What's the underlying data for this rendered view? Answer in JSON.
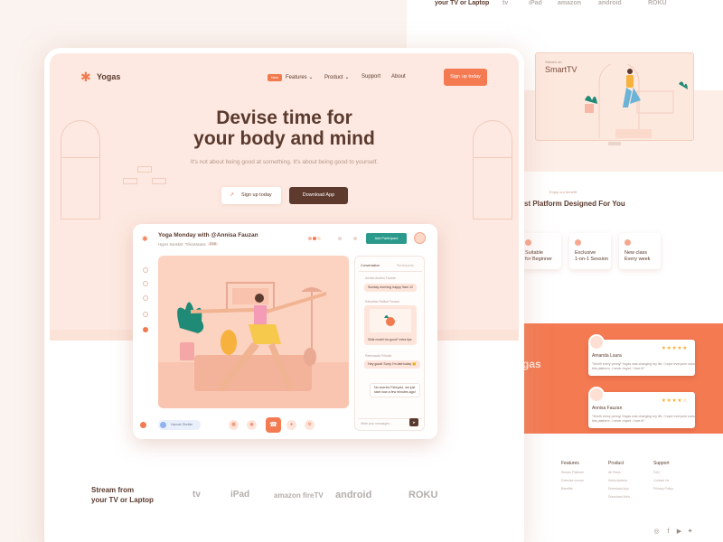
{
  "bg": {
    "stream_top": "your TV or Laptop",
    "brands_top": [
      "tv",
      "iPad",
      "amazon",
      "android",
      "ROKU"
    ],
    "smarttv_small": "Stream on",
    "smarttv_title": "SmartTV",
    "benefit_small": "Enjoy our benefit",
    "platform_title": "st Platform Designed For You",
    "features": [
      {
        "label": "Suitable\nfor Beginner"
      },
      {
        "label": "Exclusive\n1-on-1 Session"
      },
      {
        "label": "New class\nEvery week"
      }
    ],
    "brand_big": "gas",
    "reviews": [
      {
        "name": "Amanda Laura",
        "stars": "★★★★★",
        "text": "\"Worth every penny! Yogas was changing my life. I hope everyone uses this platform. I never regret. I love it!\""
      },
      {
        "name": "Annisa Fauzan",
        "stars": "★★★★☆",
        "text": "\"Worth every penny! Yogas was changing my life. I hope everyone uses this platform. I never regret. I love it!\""
      }
    ],
    "footer": [
      {
        "heading": "Features",
        "links": [
          "Stream Platform",
          "Exercise course",
          "Benefits"
        ]
      },
      {
        "heading": "Product",
        "links": [
          "All Plans",
          "Subscriptions",
          "Download App",
          "Download Web"
        ]
      },
      {
        "heading": "Support",
        "links": [
          "FAQ",
          "Contact Us",
          "Privacy Policy"
        ]
      }
    ],
    "social_icons": [
      "instagram-icon",
      "facebook-icon",
      "youtube-icon",
      "twitter-icon"
    ]
  },
  "main": {
    "logo": "Yogas",
    "nav": {
      "new_badge": "New",
      "items": [
        "Features",
        "Product",
        "Support",
        "About"
      ],
      "signup": "Sign up today"
    },
    "hero": {
      "title_line1": "Devise time for",
      "title_line2": "your body and mind",
      "subtitle": "It's not about being good at something. It's about being good to yourself.",
      "signup_btn": "Sign up today",
      "download_btn": "Download App"
    },
    "app": {
      "title": "Yoga Monday with @Annisa Fauzan",
      "subtitle": "Hyper Sanskrit: Trikonāsana",
      "badge": "2:16",
      "add_participant": "Add Participant",
      "tabs": [
        "Conversation",
        "Participants"
      ],
      "messages": [
        {
          "name": "Annisa Andrini Fauzan",
          "text": "Sunday morning happy 9am 12"
        },
        {
          "name": "Rahadian Rafikal Fauzan",
          "text": "Slide model too good? extra tips"
        },
        {
          "name": "Rahmawati Prihatin",
          "text": "Hey good! Sorry I'm late today 😊"
        },
        {
          "name": "",
          "text": "No worries Febryani, we just start now a few minutes ago!"
        }
      ],
      "chat_placeholder": "Write your messages...",
      "mute_label": "Hannah Shelbie"
    },
    "stream": {
      "title_line1": "Stream from",
      "title_line2": "your TV or Laptop",
      "brands": [
        "tv",
        "iPad",
        "amazon fireTV",
        "android",
        "ROKU"
      ]
    }
  }
}
